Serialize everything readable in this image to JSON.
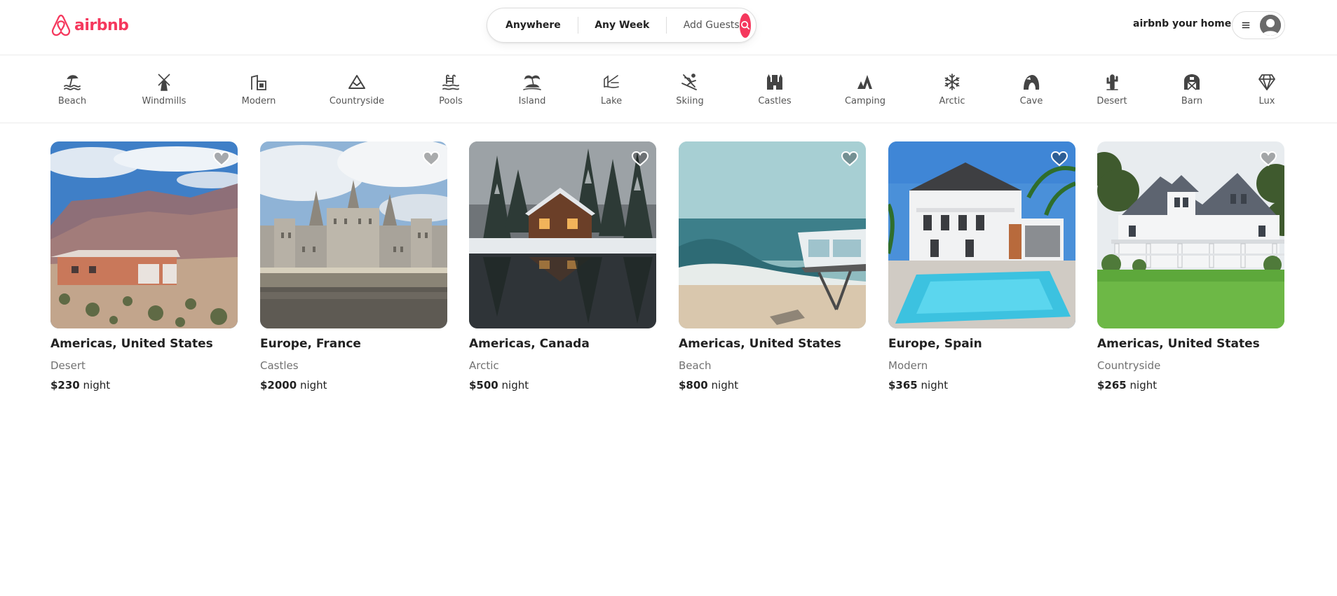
{
  "brand": {
    "name": "airbnb",
    "color": "#f5385d"
  },
  "search": {
    "where": "Anywhere",
    "when": "Any Week",
    "guests": "Add Guests",
    "icon": "search-icon"
  },
  "header": {
    "host_link": "airbnb your home",
    "menu_icon": "hamburger-icon",
    "avatar_icon": "user-avatar-icon"
  },
  "categories": [
    {
      "label": "Beach",
      "icon": "beach-icon"
    },
    {
      "label": "Windmills",
      "icon": "windmill-icon"
    },
    {
      "label": "Modern",
      "icon": "modern-house-icon"
    },
    {
      "label": "Countryside",
      "icon": "mountain-icon"
    },
    {
      "label": "Pools",
      "icon": "pool-icon"
    },
    {
      "label": "Island",
      "icon": "island-icon"
    },
    {
      "label": "Lake",
      "icon": "lake-icon"
    },
    {
      "label": "Skiing",
      "icon": "skiing-icon"
    },
    {
      "label": "Castles",
      "icon": "castle-icon"
    },
    {
      "label": "Camping",
      "icon": "camping-icon"
    },
    {
      "label": "Arctic",
      "icon": "snowflake-icon"
    },
    {
      "label": "Cave",
      "icon": "cave-icon"
    },
    {
      "label": "Desert",
      "icon": "cactus-icon"
    },
    {
      "label": "Barn",
      "icon": "barn-icon"
    },
    {
      "label": "Lux",
      "icon": "diamond-icon"
    }
  ],
  "listings": [
    {
      "location": "Americas, United States",
      "category": "Desert",
      "price": "$230",
      "unit": " night"
    },
    {
      "location": "Europe, France",
      "category": "Castles",
      "price": "$2000",
      "unit": " night"
    },
    {
      "location": "Americas, Canada",
      "category": "Arctic",
      "price": "$500",
      "unit": " night"
    },
    {
      "location": "Americas, United States",
      "category": "Beach",
      "price": "$800",
      "unit": " night"
    },
    {
      "location": "Europe, Spain",
      "category": "Modern",
      "price": "$365",
      "unit": " night"
    },
    {
      "location": "Americas, United States",
      "category": "Countryside",
      "price": "$265",
      "unit": " night"
    }
  ]
}
